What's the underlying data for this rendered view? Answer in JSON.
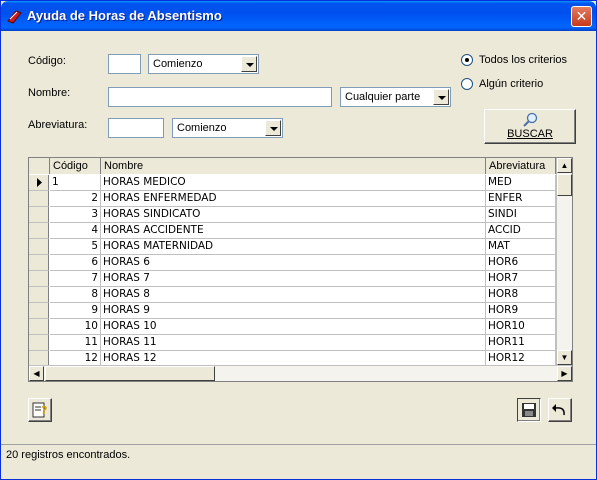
{
  "window": {
    "title": "Ayuda de Horas de Absentismo",
    "close_label": "✕"
  },
  "filters": {
    "codigo_label": "Código:",
    "codigo_value": "",
    "codigo_mode": "Comienzo",
    "nombre_label": "Nombre:",
    "nombre_value": "",
    "nombre_mode": "Cualquier parte",
    "abreviatura_label": "Abreviatura:",
    "abreviatura_value": "",
    "abreviatura_mode": "Comienzo"
  },
  "criteria": {
    "todos_label": "Todos los criterios",
    "todos_selected": true,
    "algun_label": "Algún criterio",
    "algun_selected": false
  },
  "search_button": {
    "label": "BUSCAR"
  },
  "grid": {
    "columns": [
      "Código",
      "Nombre",
      "Abreviatura"
    ],
    "current_row": 0,
    "rows": [
      {
        "codigo": "1",
        "nombre": "HORAS MEDICO",
        "abreviatura": "MED"
      },
      {
        "codigo": "2",
        "nombre": "HORAS ENFERMEDAD",
        "abreviatura": "ENFER"
      },
      {
        "codigo": "3",
        "nombre": "HORAS SINDICATO",
        "abreviatura": "SINDI"
      },
      {
        "codigo": "4",
        "nombre": "HORAS ACCIDENTE",
        "abreviatura": "ACCID"
      },
      {
        "codigo": "5",
        "nombre": "HORAS MATERNIDAD",
        "abreviatura": "MAT"
      },
      {
        "codigo": "6",
        "nombre": "HORAS 6",
        "abreviatura": "HOR6"
      },
      {
        "codigo": "7",
        "nombre": "HORAS 7",
        "abreviatura": "HOR7"
      },
      {
        "codigo": "8",
        "nombre": "HORAS 8",
        "abreviatura": "HOR8"
      },
      {
        "codigo": "9",
        "nombre": "HORAS 9",
        "abreviatura": "HOR9"
      },
      {
        "codigo": "10",
        "nombre": "HORAS 10",
        "abreviatura": "HOR10"
      },
      {
        "codigo": "11",
        "nombre": "HORAS 11",
        "abreviatura": "HOR11"
      },
      {
        "codigo": "12",
        "nombre": "HORAS 12",
        "abreviatura": "HOR12"
      }
    ]
  },
  "status": {
    "text": "20 registros encontrados."
  },
  "icons": {
    "title": "app-icon",
    "help": "help-document-icon",
    "save": "floppy-disk-icon",
    "undo": "undo-arrow-icon",
    "search": "magnifier-icon"
  }
}
